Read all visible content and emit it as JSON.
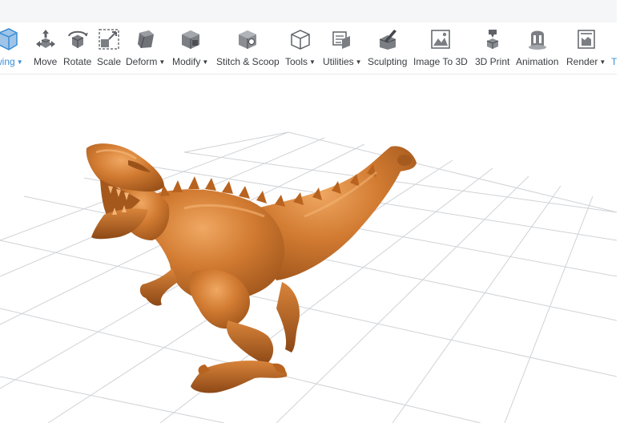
{
  "toolbar": {
    "items": [
      {
        "label": "wing",
        "icon": "viewing-cube-icon",
        "dropdown": true,
        "active": true
      },
      {
        "label": "Move",
        "icon": "move-icon"
      },
      {
        "label": "Rotate",
        "icon": "rotate-icon"
      },
      {
        "label": "Scale",
        "icon": "scale-icon"
      },
      {
        "label": "Deform",
        "icon": "deform-icon",
        "dropdown": true
      },
      {
        "label": "Modify",
        "icon": "modify-icon",
        "dropdown": true
      },
      {
        "label": "Stitch & Scoop",
        "icon": "stitch-scoop-icon"
      },
      {
        "label": "Tools",
        "icon": "tools-icon",
        "dropdown": true
      },
      {
        "label": "Utilities",
        "icon": "utilities-icon",
        "dropdown": true
      },
      {
        "label": "Sculpting",
        "icon": "sculpting-icon"
      },
      {
        "label": "Image To 3D",
        "icon": "image-to-3d-icon"
      },
      {
        "label": "3D Print",
        "icon": "3d-print-icon"
      },
      {
        "label": "Animation",
        "icon": "animation-icon"
      },
      {
        "label": "Render",
        "icon": "render-icon",
        "dropdown": true
      },
      {
        "label": "T",
        "icon": "",
        "active": true
      }
    ]
  },
  "colors": {
    "model": "#c8742d",
    "model_highlight": "#e79a55",
    "model_shadow": "#8c4816",
    "grid": "#cfd2d6",
    "accent": "#3a8ed6"
  }
}
